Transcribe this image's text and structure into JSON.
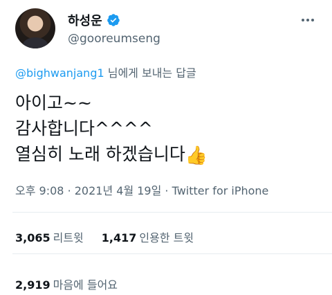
{
  "author": {
    "display_name": "하성운",
    "handle": "@gooreumseng",
    "verified_icon": "verified-badge-icon",
    "verified_color": "#1d9bf0"
  },
  "reply": {
    "mention": "@bighwanjang1",
    "suffix": " 님에게 보내는 답글"
  },
  "tweet": {
    "lines": [
      "아이고~~",
      "감사합니다^^^^",
      "열심히 노래 하겠습니다"
    ],
    "emoji": "👍"
  },
  "meta": {
    "time": "오후 9:08",
    "date": "2021년 4월 19일",
    "source": "Twitter for iPhone"
  },
  "stats": {
    "retweets": {
      "count": "3,065",
      "label": "리트윗"
    },
    "quotes": {
      "count": "1,417",
      "label": "인용한 트윗"
    },
    "likes": {
      "count": "2,919",
      "label": "마음에 들어요"
    }
  },
  "colors": {
    "accent": "#1d9bf0",
    "secondary_text": "#536471",
    "primary_text": "#0f1419"
  }
}
